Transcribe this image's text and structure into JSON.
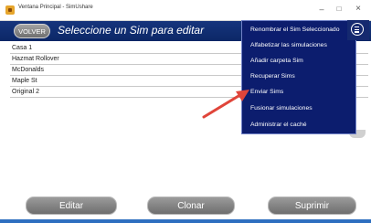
{
  "window": {
    "title": "Ventana Principal - SimUshare",
    "controls": {
      "minimize": "–",
      "maximize": "□",
      "close": "×"
    }
  },
  "header": {
    "back_label": "VOLVER",
    "title": "Seleccione un Sim para editar",
    "menu_icon": "hamburger-circle-icon"
  },
  "sims": [
    {
      "name": "Casa 1"
    },
    {
      "name": "Hazmat Rollover"
    },
    {
      "name": "McDonalds"
    },
    {
      "name": "Maple St"
    },
    {
      "name": "Original 2"
    }
  ],
  "menu": {
    "items": [
      {
        "label": "Renombrar el Sim Seleccionado"
      },
      {
        "label": "Alfabetizar las simulaciones"
      },
      {
        "label": "Añadir carpeta Sim"
      },
      {
        "label": "Recuperar Sims"
      },
      {
        "label": "Enviar Sims"
      },
      {
        "label": "Fusionar simulaciones"
      },
      {
        "label": "Administrar el caché"
      }
    ]
  },
  "footer": {
    "edit_label": "Editar",
    "clone_label": "Clonar",
    "delete_label": "Suprimir"
  },
  "colors": {
    "header": "#16357d",
    "menu_background": "#0c1d6e",
    "arrow": "#e0453a",
    "button_gray": "#8a8a8a",
    "bottom_line": "#2e6fc0"
  }
}
